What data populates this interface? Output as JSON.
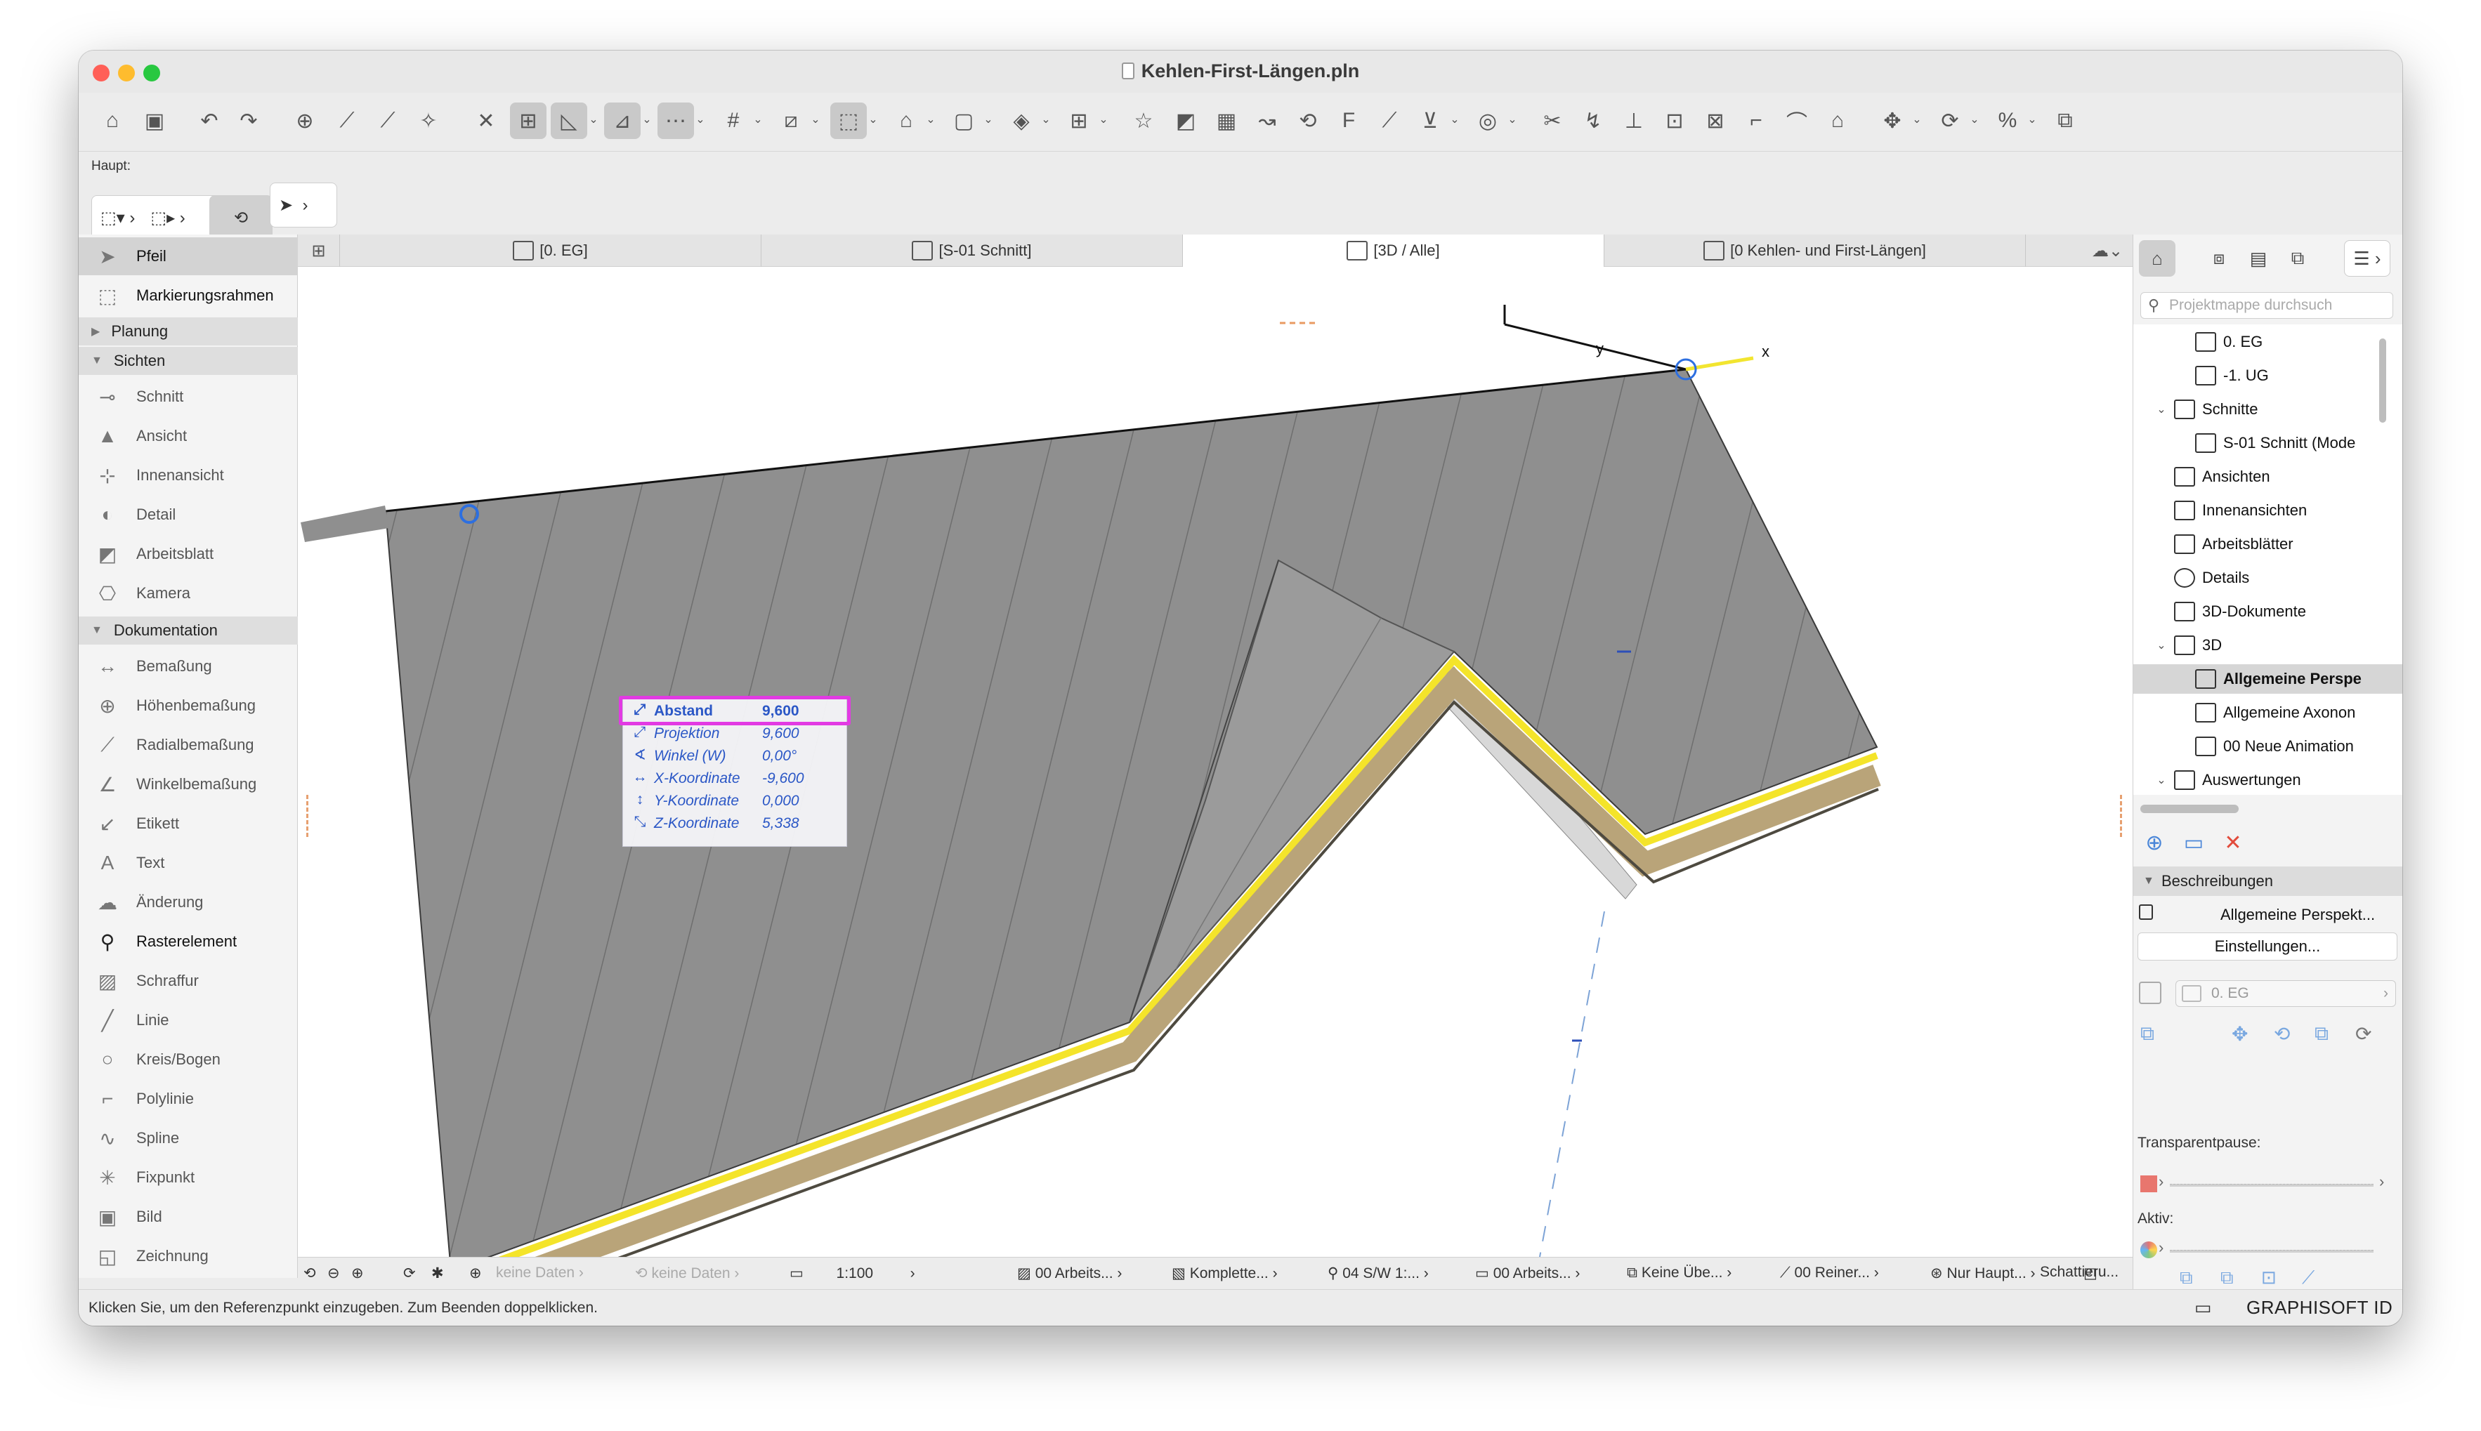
{
  "window": {
    "title": "Kehlen-First-Längen.pln"
  },
  "toolbar": {
    "haupt_label": "Haupt:"
  },
  "toolbox": {
    "tools_top": [
      {
        "label": "Pfeil",
        "icon": "arrow-pointer-icon",
        "selected": true
      },
      {
        "label": "Markierungsrahmen",
        "icon": "marquee-icon"
      }
    ],
    "sections": {
      "planung": "Planung",
      "sichten": "Sichten",
      "dokumentation": "Dokumentation"
    },
    "sichten_tools": [
      {
        "label": "Schnitt",
        "icon": "section-icon"
      },
      {
        "label": "Ansicht",
        "icon": "elevation-icon"
      },
      {
        "label": "Innenansicht",
        "icon": "interior-elevation-icon"
      },
      {
        "label": "Detail",
        "icon": "detail-icon"
      },
      {
        "label": "Arbeitsblatt",
        "icon": "worksheet-icon"
      },
      {
        "label": "Kamera",
        "icon": "camera-icon"
      }
    ],
    "doku_tools": [
      {
        "label": "Bemaßung",
        "icon": "dimension-icon"
      },
      {
        "label": "Höhenbemaßung",
        "icon": "level-dimension-icon"
      },
      {
        "label": "Radialbemaßung",
        "icon": "radial-dimension-icon"
      },
      {
        "label": "Winkelbemaßung",
        "icon": "angle-dimension-icon"
      },
      {
        "label": "Etikett",
        "icon": "label-icon"
      },
      {
        "label": "Text",
        "icon": "text-icon"
      },
      {
        "label": "Änderung",
        "icon": "change-icon"
      },
      {
        "label": "Rasterelement",
        "icon": "grid-element-icon",
        "dark": true
      },
      {
        "label": "Schraffur",
        "icon": "fill-icon"
      },
      {
        "label": "Linie",
        "icon": "line-icon"
      },
      {
        "label": "Kreis/Bogen",
        "icon": "arc-icon"
      },
      {
        "label": "Polylinie",
        "icon": "polyline-icon"
      },
      {
        "label": "Spline",
        "icon": "spline-icon"
      },
      {
        "label": "Fixpunkt",
        "icon": "hotspot-icon"
      },
      {
        "label": "Bild",
        "icon": "image-icon"
      },
      {
        "label": "Zeichnung",
        "icon": "drawing-icon"
      }
    ]
  },
  "tabs": [
    {
      "label": "[0. EG]",
      "icon": "floor-plan-icon"
    },
    {
      "label": "[S-01 Schnitt]",
      "icon": "section-view-icon"
    },
    {
      "label": "[3D / Alle]",
      "icon": "3d-view-icon",
      "active": true
    },
    {
      "label": "[0 Kehlen- und First-Längen]",
      "icon": "schedule-icon"
    }
  ],
  "tracker": {
    "rows": [
      {
        "label": "Abstand",
        "value": "9,600",
        "icon": "distance-icon",
        "highlight": true
      },
      {
        "label": "Projektion",
        "value": "9,600",
        "icon": "projection-icon"
      },
      {
        "label": "Winkel (W)",
        "value": "0,00°",
        "icon": "angle-icon"
      },
      {
        "label": "X-Koordinate",
        "value": "-9,600",
        "icon": "x-coordinate-icon"
      },
      {
        "label": "Y-Koordinate",
        "value": "0,000",
        "icon": "y-coordinate-icon"
      },
      {
        "label": "Z-Koordinate",
        "value": "5,338",
        "icon": "z-coordinate-icon"
      }
    ]
  },
  "axes": {
    "x": "x",
    "y": "y"
  },
  "viewbar": {
    "layer_combo": "keine Daten",
    "model_view": "keine Daten",
    "scale": "1:100",
    "layers": "00 Arbeits...",
    "structure": "Komplette...",
    "pen_set": "04 S/W 1:...",
    "model_view_opts": "00 Arbeits...",
    "overrides": "Keine Übe...",
    "renovation": "00 Reiner...",
    "partial": "Nur Haupt...",
    "shading": "Schattieru..."
  },
  "status": {
    "text": "Klicken Sie, um den Referenzpunkt einzugeben. Zum Beenden doppelklicken.",
    "brand": "GRAPHISOFT ID"
  },
  "navigator": {
    "search_placeholder": "Projektmappe durchsuch",
    "tree": [
      {
        "label": "0. EG",
        "indent": 2,
        "icon": "floor-plan-icon"
      },
      {
        "label": "-1. UG",
        "indent": 2,
        "icon": "floor-plan-icon"
      },
      {
        "label": "Schnitte",
        "indent": 1,
        "icon": "section-view-icon",
        "open": true
      },
      {
        "label": "S-01 Schnitt (Mode",
        "indent": 2,
        "icon": "section-view-icon"
      },
      {
        "label": "Ansichten",
        "indent": 1,
        "icon": "elevation-icon"
      },
      {
        "label": "Innenansichten",
        "indent": 1,
        "icon": "interior-elevation-icon"
      },
      {
        "label": "Arbeitsblätter",
        "indent": 1,
        "icon": "worksheet-icon"
      },
      {
        "label": "Details",
        "indent": 1,
        "icon": "detail-icon"
      },
      {
        "label": "3D-Dokumente",
        "indent": 1,
        "icon": "3d-document-icon"
      },
      {
        "label": "3D",
        "indent": 1,
        "icon": "3d-view-icon",
        "open": true
      },
      {
        "label": "Allgemeine Perspe",
        "indent": 2,
        "icon": "3d-view-icon",
        "selected": true
      },
      {
        "label": "Allgemeine Axonon",
        "indent": 2,
        "icon": "3d-view-icon"
      },
      {
        "label": "00 Neue Animation",
        "indent": 2,
        "icon": "animation-icon"
      },
      {
        "label": "Auswertungen",
        "indent": 1,
        "icon": "schedule-icon",
        "open": true
      }
    ],
    "descriptions_title": "Beschreibungen",
    "description_name": "Allgemeine Perspekt...",
    "settings_label": "Einstellungen...",
    "story_label": "0. EG",
    "transparency_label": "Transparentpause:",
    "active_label": "Aktiv:"
  }
}
